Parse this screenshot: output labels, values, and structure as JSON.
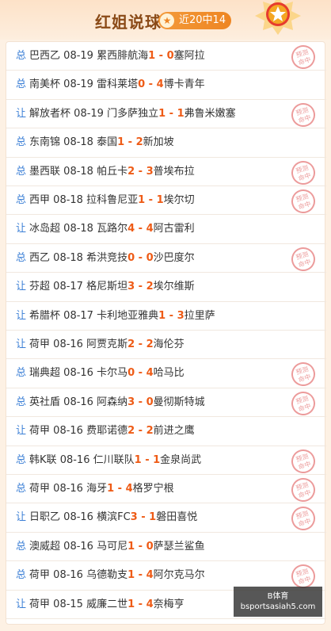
{
  "header": {
    "title": "红姐说球",
    "badge_text": "近20中14",
    "badge_icon": "star-icon"
  },
  "stamp_line1": "预测",
  "stamp_line2": "命中",
  "rows": [
    {
      "type": "总",
      "league": "巴西乙",
      "date": "08-19",
      "home": "累西腓航海",
      "hs": "1",
      "sep": " - ",
      "as": "0",
      "away": "塞阿拉",
      "hit": true
    },
    {
      "type": "总",
      "league": "南美杯",
      "date": "08-19",
      "home": "雷科莱塔",
      "hs": "0",
      "sep": " - ",
      "as": "4",
      "away": "博卡青年",
      "hit": false
    },
    {
      "type": "让",
      "league": "解放者杯",
      "date": "08-19",
      "home": "门多萨独立",
      "hs": "1",
      "sep": " - ",
      "as": "1",
      "away": "弗鲁米嫩塞",
      "hit": true
    },
    {
      "type": "总",
      "league": "东南锦",
      "date": "08-18",
      "home": "泰国",
      "hs": "1",
      "sep": " - ",
      "as": "2",
      "away": "新加坡",
      "hit": false
    },
    {
      "type": "总",
      "league": "墨西联",
      "date": "08-18",
      "home": "帕丘卡",
      "hs": "2",
      "sep": " - ",
      "as": "3",
      "away": "普埃布拉",
      "hit": true
    },
    {
      "type": "总",
      "league": "西甲",
      "date": "08-18",
      "home": "拉科鲁尼亚",
      "hs": "1",
      "sep": " - ",
      "as": "1",
      "away": "埃尔切",
      "hit": true
    },
    {
      "type": "让",
      "league": "冰岛超",
      "date": "08-18",
      "home": "瓦路尔",
      "hs": "4",
      "sep": " - ",
      "as": "4",
      "away": "阿古雷利",
      "hit": false
    },
    {
      "type": "总",
      "league": "西乙",
      "date": "08-18",
      "home": "希洪竞技",
      "hs": "0",
      "sep": " - ",
      "as": "0",
      "away": "沙巴度尔",
      "hit": true
    },
    {
      "type": "让",
      "league": "芬超",
      "date": "08-17",
      "home": "格尼斯坦",
      "hs": "3",
      "sep": " - ",
      "as": "2",
      "away": "埃尔维斯",
      "hit": false
    },
    {
      "type": "让",
      "league": "希腊杯",
      "date": "08-17",
      "home": "卡利地亚雅典",
      "hs": "1",
      "sep": " - ",
      "as": "3",
      "away": "拉里萨",
      "hit": false
    },
    {
      "type": "让",
      "league": "荷甲",
      "date": "08-16",
      "home": "阿贾克斯",
      "hs": "2",
      "sep": " - ",
      "as": "2",
      "away": "海伦芬",
      "hit": false
    },
    {
      "type": "总",
      "league": "瑞典超",
      "date": "08-16",
      "home": "卡尔马",
      "hs": "0",
      "sep": " - ",
      "as": "4",
      "away": "哈马比",
      "hit": true
    },
    {
      "type": "总",
      "league": "英社盾",
      "date": "08-16",
      "home": "阿森纳",
      "hs": "3",
      "sep": " - ",
      "as": "0",
      "away": "曼彻斯特城",
      "hit": true
    },
    {
      "type": "让",
      "league": "荷甲",
      "date": "08-16",
      "home": "费耶诺德",
      "hs": "2",
      "sep": " - ",
      "as": "2",
      "away": "前进之鹰",
      "hit": false
    },
    {
      "type": "总",
      "league": "韩K联",
      "date": "08-16",
      "home": "仁川联队",
      "hs": "1",
      "sep": " - ",
      "as": "1",
      "away": "金泉尚武",
      "hit": true
    },
    {
      "type": "总",
      "league": "荷甲",
      "date": "08-16",
      "home": "海牙",
      "hs": "1",
      "sep": " - ",
      "as": "4",
      "away": "格罗宁根",
      "hit": true
    },
    {
      "type": "让",
      "league": "日职乙",
      "date": "08-16",
      "home": "横滨FC",
      "hs": "3",
      "sep": " - ",
      "as": "1",
      "away": "磐田喜悦",
      "hit": true
    },
    {
      "type": "总",
      "league": "澳威超",
      "date": "08-16",
      "home": "马可尼",
      "hs": "1",
      "sep": " - ",
      "as": "0",
      "away": "萨瑟兰鲨鱼",
      "hit": false
    },
    {
      "type": "总",
      "league": "荷甲",
      "date": "08-16",
      "home": "乌德勒支",
      "hs": "1",
      "sep": " - ",
      "as": "4",
      "away": "阿尔克马尔",
      "hit": true
    },
    {
      "type": "让",
      "league": "荷甲",
      "date": "08-15",
      "home": "威廉二世",
      "hs": "1",
      "sep": " - ",
      "as": "4",
      "away": "奈梅亨",
      "hit": false
    }
  ],
  "watermark": {
    "line1": "B体育",
    "line2": "bsportsasiah5.com"
  },
  "colors": {
    "accent": "#ee5b16",
    "type": "#3b7fd6",
    "stamp": "#e98a8a"
  }
}
